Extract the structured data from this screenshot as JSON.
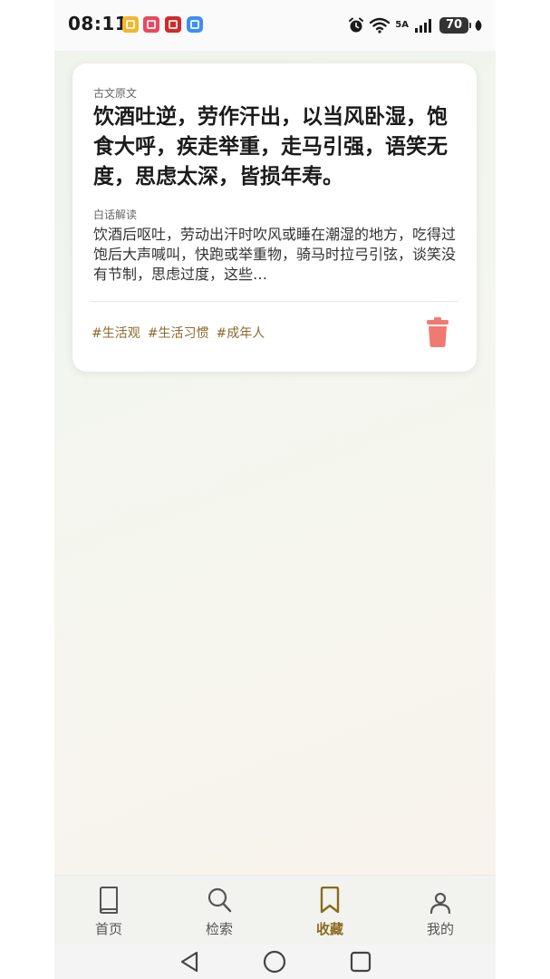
{
  "status_bar": {
    "time": "08:11",
    "network": "5A",
    "battery": "70"
  },
  "card": {
    "original_label": "古文原文",
    "original_text": "饮酒吐逆，劳作汗出，以当风卧湿，饱食大呼，疾走举重，走马引强，语笑无度，思虑太深，皆损年寿。",
    "translation_label": "白话解读",
    "translation_text": "饮酒后呕吐，劳动出汗时吹风或睡在潮湿的地方，吃得过饱后大声喊叫，快跑或举重物，骑马时拉弓引弦，谈笑没有节制，思虑过度，这些…",
    "tags": [
      "#生活观",
      "#生活习惯",
      "#成年人"
    ],
    "delete_icon": "trash-icon"
  },
  "tab_bar": {
    "tabs": [
      {
        "label": "首页",
        "icon": "book-icon"
      },
      {
        "label": "检索",
        "icon": "search-icon"
      },
      {
        "label": "收藏",
        "icon": "bookmark-icon",
        "active": true
      },
      {
        "label": "我的",
        "icon": "user-icon"
      }
    ]
  },
  "colors": {
    "accent": "#8b6a1f",
    "tag_text": "#8b6a2b",
    "delete": "#ef7a72"
  }
}
